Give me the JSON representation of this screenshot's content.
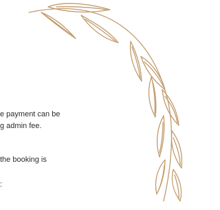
{
  "text_lines": [
    "e payment can be",
    "g admin fee.",
    " the booking is",
    ":"
  ],
  "decoration": {
    "icon": "laurel-branch-icon",
    "stroke_color": "#c19a6b"
  },
  "background_color": "#ffffff"
}
